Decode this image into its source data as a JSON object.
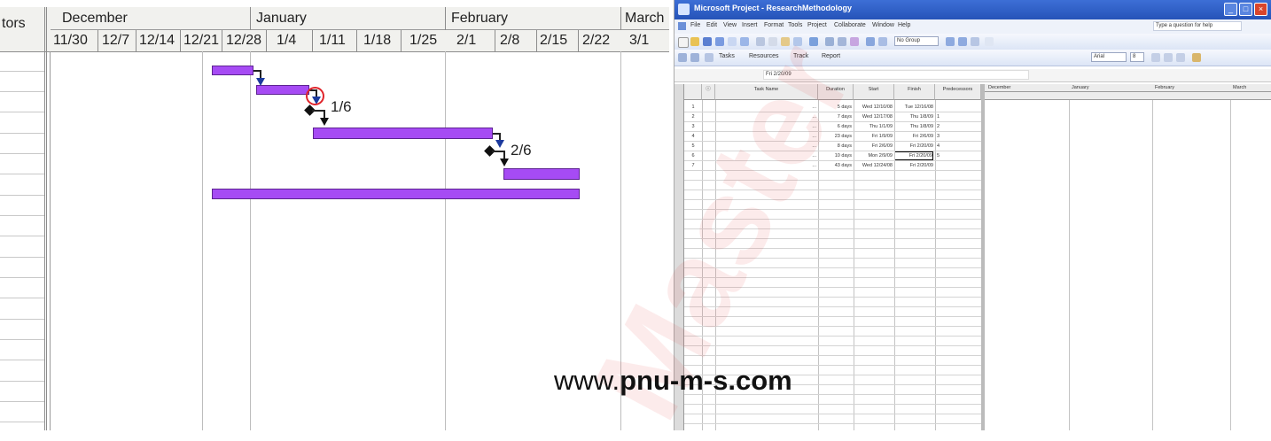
{
  "left_gantt": {
    "left_column_header": "tors",
    "months": [
      "December",
      "January",
      "February",
      "March"
    ],
    "weeks": [
      "11/30",
      "12/7",
      "12/14",
      "12/21",
      "12/28",
      "1/4",
      "1/11",
      "1/18",
      "1/25",
      "2/1",
      "2/8",
      "2/15",
      "2/22",
      "3/1"
    ],
    "milestones": [
      {
        "label": "1/6"
      },
      {
        "label": "2/6"
      }
    ]
  },
  "project_window": {
    "title": "Microsoft Project - ResearchMethodology",
    "menu": [
      "File",
      "Edit",
      "View",
      "Insert",
      "Format",
      "Tools",
      "Project",
      "Collaborate",
      "Window",
      "Help"
    ],
    "help_box": "Type a question for help",
    "toolbar2": {
      "group_box": "No Group",
      "font_box": "Arial",
      "size_box": "8"
    },
    "toolbar3": {
      "items": [
        "Tasks",
        "Resources",
        "Track",
        "Report"
      ]
    },
    "entry_text": "Fri 2/20/09",
    "columns": [
      "",
      "Task Name",
      "Duration",
      "Start",
      "Finish",
      "Predecessors"
    ],
    "gantt_header": {
      "months": [
        "December",
        "January",
        "February",
        "March"
      ]
    },
    "rows": [
      {
        "id": "1",
        "name": "...",
        "duration": "5 days",
        "start": "Wed 12/10/08",
        "finish": "Tue 12/16/08",
        "pred": ""
      },
      {
        "id": "2",
        "name": "...",
        "duration": "7 days",
        "start": "Wed 12/17/08",
        "finish": "Thu 1/8/09",
        "pred": "1"
      },
      {
        "id": "3",
        "name": "...",
        "duration": "6 days",
        "start": "Thu 1/1/09",
        "finish": "Thu 1/8/09",
        "pred": "2"
      },
      {
        "id": "4",
        "name": "...",
        "duration": "23 days",
        "start": "Fri 1/9/09",
        "finish": "Fri 2/6/09",
        "pred": "3"
      },
      {
        "id": "5",
        "name": "...",
        "duration": "8 days",
        "start": "Fri 2/6/09",
        "finish": "Fri 2/20/09",
        "pred": "4"
      },
      {
        "id": "6",
        "name": "...",
        "duration": "10 days",
        "start": "Mon 2/9/09",
        "finish": "Fri 2/20/09",
        "pred": "5"
      },
      {
        "id": "7",
        "name": "...",
        "duration": "43 days",
        "start": "Wed 12/24/08",
        "finish": "Fri 2/20/09",
        "pred": ""
      }
    ]
  },
  "overlay": {
    "site_prefix": "www.",
    "site_bold": "pnu-m-s.com",
    "watermark": "Master"
  }
}
